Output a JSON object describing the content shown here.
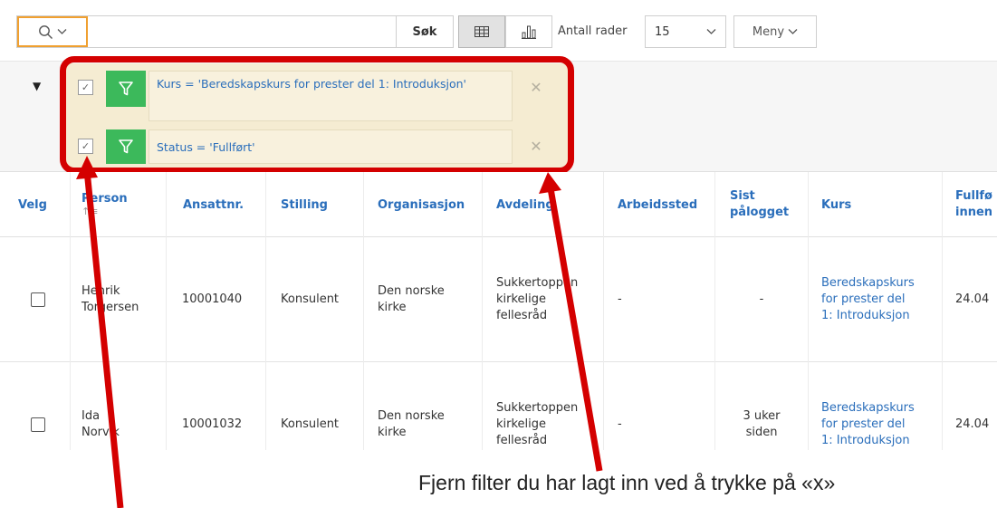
{
  "toolbar": {
    "search_placeholder": "",
    "search_icon": "search-icon",
    "sok_label": "Søk",
    "rows_label": "Antall rader",
    "rows_value": "15",
    "meny_label": "Meny"
  },
  "filters": [
    {
      "text": "Kurs = 'Beredskapskurs for prester del 1: Introduksjon'",
      "checked": true
    },
    {
      "text": "Status = 'Fullført'",
      "checked": true
    }
  ],
  "table": {
    "headers": [
      "Velg",
      "Person",
      "Ansattnr.",
      "Stilling",
      "Organisasjon",
      "Avdeling",
      "Arbeidssted",
      "Sist pålogget",
      "Kurs",
      "Fullført innen"
    ],
    "header_lines": {
      "sist": [
        "Sist",
        "pålogget"
      ],
      "fullfort": [
        "Fullfø",
        "innen"
      ]
    },
    "rows": [
      {
        "person": [
          "Henrik",
          "Torgersen"
        ],
        "ansattnr": "10001040",
        "stilling": "Konsulent",
        "organisasjon": [
          "Den norske",
          "kirke"
        ],
        "avdeling": [
          "Sukkertoppen",
          "kirkelige",
          "fellesråd"
        ],
        "arbeidssted": "-",
        "sist": [
          "-"
        ],
        "kurs": [
          "Beredskapskurs",
          "for prester del",
          "1: Introduksjon"
        ],
        "fullfort": "24.04"
      },
      {
        "person": [
          "Ida",
          "Norvik"
        ],
        "ansattnr": "10001032",
        "stilling": "Konsulent",
        "organisasjon": [
          "Den norske",
          "kirke"
        ],
        "avdeling": [
          "Sukkertoppen",
          "kirkelige",
          "fellesråd"
        ],
        "arbeidssted": "-",
        "sist": [
          "3 uker",
          "siden"
        ],
        "kurs": [
          "Beredskapskurs",
          "for prester del",
          "1: Introduksjon"
        ],
        "fullfort": "24.04"
      }
    ]
  },
  "annotation": {
    "caption": "Fjern filter du har lagt inn ved å trykke på «x»",
    "color": "#d40000"
  }
}
